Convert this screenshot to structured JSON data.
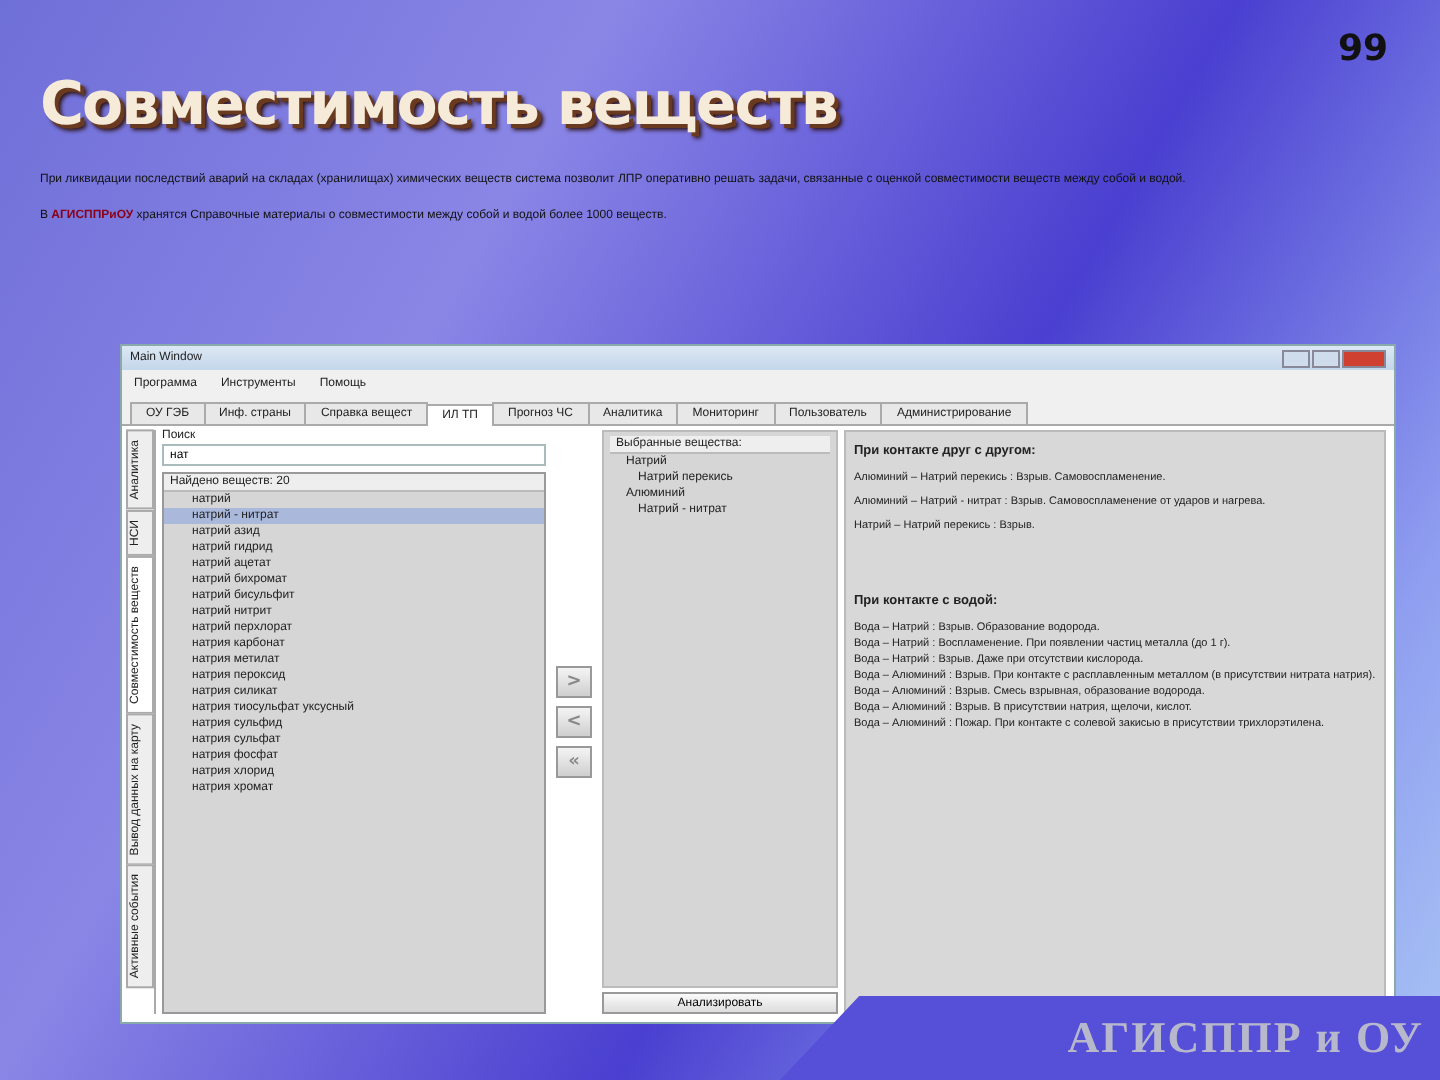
{
  "slide": {
    "number": "99",
    "title": "Совместимость веществ",
    "paragraphs": [
      {
        "text": "При ликвидации последствий аварий на складах (хранилищах) химических веществ система позволит ЛПР оперативно решать задачи, связанные с оценкой совместимости веществ между собой и водой."
      },
      {
        "text": "В **АГИСППРиОУ** хранятся Справочные материалы о совместимости  между собой и водой более 1000 веществ."
      }
    ],
    "footer": "АГИСППР и ОУ"
  },
  "window": {
    "title": "Main Window",
    "menu": [
      "Программа",
      "Инструменты",
      "Помощь"
    ],
    "tabs": [
      {
        "label": "ОУ ГЭБ",
        "selected": false
      },
      {
        "label": "Инф. страны",
        "selected": false
      },
      {
        "label": "Справка вещест",
        "selected": false
      },
      {
        "label": "ИЛ ТП",
        "selected": true
      },
      {
        "label": "Прогноз ЧС",
        "selected": false
      },
      {
        "label": "Аналитика",
        "selected": false
      },
      {
        "label": "Мониторинг",
        "selected": false
      },
      {
        "label": "Пользователь",
        "selected": false
      },
      {
        "label": "Администрирование",
        "selected": false
      }
    ],
    "side_tabs": [
      {
        "label": "Аналитика",
        "selected": false
      },
      {
        "label": "НСИ",
        "selected": false
      },
      {
        "label": "Совместимость веществ",
        "selected": true
      },
      {
        "label": "Вывод данных на карту",
        "selected": false
      },
      {
        "label": "Активные события",
        "selected": false
      }
    ],
    "search": {
      "label": "Поиск",
      "value": "нат"
    },
    "found": {
      "header": "Найдено веществ: 20",
      "items": [
        {
          "label": "натрий",
          "selected": false
        },
        {
          "label": "натрий - нитрат",
          "selected": true
        },
        {
          "label": "натрий азид",
          "selected": false
        },
        {
          "label": "натрий гидрид",
          "selected": false
        },
        {
          "label": "натрий ацетат",
          "selected": false
        },
        {
          "label": "натрий бихромат",
          "selected": false
        },
        {
          "label": "натрий бисульфит",
          "selected": false
        },
        {
          "label": "натрий нитрит",
          "selected": false
        },
        {
          "label": "натрий перхлорат",
          "selected": false
        },
        {
          "label": "натрия карбонат",
          "selected": false
        },
        {
          "label": "натрия метилат",
          "selected": false
        },
        {
          "label": "натрия пероксид",
          "selected": false
        },
        {
          "label": "натрия силикат",
          "selected": false
        },
        {
          "label": "натрия тиосульфат уксусный",
          "selected": false
        },
        {
          "label": "натрия сульфид",
          "selected": false
        },
        {
          "label": "натрия сульфат",
          "selected": false
        },
        {
          "label": "натрия фосфат",
          "selected": false
        },
        {
          "label": "натрия хлорид",
          "selected": false
        },
        {
          "label": "натрия хромат",
          "selected": false
        }
      ]
    },
    "move_buttons": [
      ">",
      "<",
      "«"
    ],
    "chosen": {
      "header": "Выбранные вещества:",
      "items": [
        {
          "label": "Натрий",
          "children": [
            {
              "label": "Натрий перекись"
            }
          ]
        },
        {
          "label": "Алюминий",
          "children": [
            {
              "label": "Натрий - нитрат"
            }
          ]
        }
      ]
    },
    "analyze_button": "Анализировать",
    "results": [
      {
        "heading": "При контакте друг с другом:",
        "lines": [
          "Алюминий – Натрий перекись : Взрыв. Самовоспламенение.",
          "Алюминий – Натрий - нитрат : Взрыв. Самовоспламенение от ударов и нагрева.",
          "Натрий – Натрий перекись : Взрыв."
        ]
      },
      {
        "heading": "При контакте с водой:",
        "lines": [
          "Вода – Натрий : Взрыв. Образование водорода.",
          "Вода – Натрий : Воспламенение. При появлении частиц металла (до 1 г).",
          "Вода – Натрий : Взрыв. Даже при отсутствии кислорода.",
          "Вода – Алюминий : Взрыв. При контакте с расплавленным металлом (в присутствии нитрата натрия).",
          "Вода – Алюминий : Взрыв. Смесь взрывная, образование водорода.",
          "Вода – Алюминий : Взрыв. В присутствии натрия, щелочи, кислот.",
          "Вода – Алюминий : Пожар. При контакте с солевой закисью в присутствии трихлорэтилена."
        ]
      }
    ]
  }
}
